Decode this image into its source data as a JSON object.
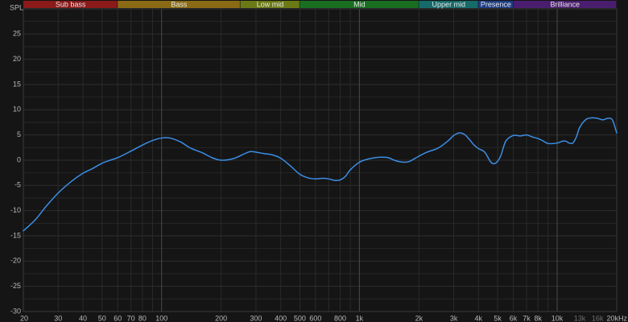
{
  "chart_data": {
    "type": "line",
    "title": "",
    "xlabel": "",
    "ylabel": "SPL",
    "x_scale": "log",
    "xlim": [
      20,
      20000
    ],
    "ylim": [
      -30,
      30
    ],
    "grid": true,
    "colors": {
      "background": "#151515",
      "grid_minor": "#262626",
      "grid_major": "#4a4a4a",
      "line": "#3b8ee6"
    },
    "y_ticks": [
      {
        "value": 25,
        "label": "25"
      },
      {
        "value": 20,
        "label": "20"
      },
      {
        "value": 15,
        "label": "15"
      },
      {
        "value": 10,
        "label": "10"
      },
      {
        "value": 5,
        "label": "5"
      },
      {
        "value": 0,
        "label": "0"
      },
      {
        "value": -5,
        "label": "-5"
      },
      {
        "value": -10,
        "label": "-10"
      },
      {
        "value": -15,
        "label": "-15"
      },
      {
        "value": -20,
        "label": "-20"
      },
      {
        "value": -25,
        "label": "-25"
      },
      {
        "value": -30,
        "label": "-30"
      }
    ],
    "x_ticks": [
      {
        "value": 20,
        "label": "20"
      },
      {
        "value": 30,
        "label": "30"
      },
      {
        "value": 40,
        "label": "40"
      },
      {
        "value": 50,
        "label": "50"
      },
      {
        "value": 60,
        "label": "60"
      },
      {
        "value": 70,
        "label": "70"
      },
      {
        "value": 80,
        "label": "80"
      },
      {
        "value": 100,
        "label": "100"
      },
      {
        "value": 200,
        "label": "200"
      },
      {
        "value": 300,
        "label": "300"
      },
      {
        "value": 400,
        "label": "400"
      },
      {
        "value": 500,
        "label": "500"
      },
      {
        "value": 600,
        "label": "600"
      },
      {
        "value": 800,
        "label": "800"
      },
      {
        "value": 1000,
        "label": "1k"
      },
      {
        "value": 2000,
        "label": "2k"
      },
      {
        "value": 3000,
        "label": "3k"
      },
      {
        "value": 4000,
        "label": "4k"
      },
      {
        "value": 5000,
        "label": "5k"
      },
      {
        "value": 6000,
        "label": "6k"
      },
      {
        "value": 7000,
        "label": "7k"
      },
      {
        "value": 8000,
        "label": "8k"
      },
      {
        "value": 10000,
        "label": "10k"
      },
      {
        "value": 13000,
        "label": "13k",
        "dim": true
      },
      {
        "value": 16000,
        "label": "16k",
        "dim": true
      },
      {
        "value": 20000,
        "label": "20kHz"
      }
    ],
    "bands": [
      {
        "name": "Sub bass",
        "from": 20,
        "to": 60,
        "color": "#8b1a1a"
      },
      {
        "name": "Bass",
        "from": 60,
        "to": 250,
        "color": "#8a6a14"
      },
      {
        "name": "Low mid",
        "from": 250,
        "to": 500,
        "color": "#6b7a14"
      },
      {
        "name": "Mid",
        "from": 500,
        "to": 2000,
        "color": "#1a6e22"
      },
      {
        "name": "Upper mid",
        "from": 2000,
        "to": 4000,
        "color": "#166a6a"
      },
      {
        "name": "Presence",
        "from": 4000,
        "to": 6000,
        "color": "#1e3c86"
      },
      {
        "name": "Brilliance",
        "from": 6000,
        "to": 20000,
        "color": "#4a1e6e"
      }
    ],
    "series": [
      {
        "x": [
          20,
          23,
          26,
          30,
          35,
          40,
          45,
          50,
          55,
          60,
          70,
          80,
          90,
          100,
          110,
          125,
          140,
          160,
          180,
          200,
          230,
          260,
          280,
          300,
          330,
          360,
          400,
          450,
          500,
          550,
          600,
          650,
          700,
          750,
          800,
          850,
          900,
          1000,
          1100,
          1200,
          1300,
          1400,
          1500,
          1600,
          1700,
          1800,
          2000,
          2200,
          2500,
          2800,
          3000,
          3200,
          3400,
          3600,
          3800,
          4000,
          4300,
          4600,
          4800,
          5000,
          5200,
          5500,
          6000,
          6500,
          7000,
          7500,
          8000,
          8500,
          9000,
          10000,
          10500,
          11000,
          11500,
          12000,
          12500,
          13000,
          14000,
          15000,
          16000,
          17000,
          18000,
          19000,
          20000
        ],
        "y": [
          -14.0,
          -11.8,
          -9.2,
          -6.5,
          -4.2,
          -2.6,
          -1.6,
          -0.6,
          0.0,
          0.5,
          1.8,
          3.0,
          3.9,
          4.4,
          4.4,
          3.6,
          2.4,
          1.5,
          0.5,
          0.0,
          0.3,
          1.2,
          1.7,
          1.6,
          1.3,
          1.1,
          0.4,
          -1.2,
          -2.8,
          -3.5,
          -3.7,
          -3.6,
          -3.7,
          -4.0,
          -3.9,
          -3.2,
          -1.9,
          -0.4,
          0.2,
          0.5,
          0.6,
          0.5,
          0.0,
          -0.3,
          -0.4,
          -0.2,
          0.8,
          1.6,
          2.4,
          3.8,
          4.9,
          5.4,
          5.1,
          4.1,
          3.0,
          2.3,
          1.6,
          -0.3,
          -0.7,
          -0.2,
          1.0,
          3.8,
          4.9,
          4.8,
          5.0,
          4.6,
          4.3,
          3.8,
          3.3,
          3.4,
          3.7,
          3.8,
          3.4,
          3.4,
          4.6,
          6.5,
          8.1,
          8.4,
          8.3,
          8.0,
          8.3,
          8.0,
          5.4
        ]
      }
    ]
  }
}
